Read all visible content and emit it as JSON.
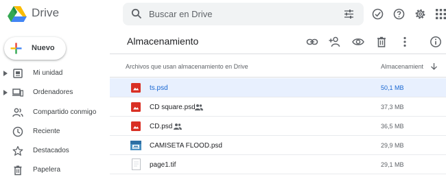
{
  "app": {
    "brand": "Drive"
  },
  "search": {
    "placeholder": "Buscar en Drive"
  },
  "top_icons": [
    "checkmark-circle-icon",
    "help-icon",
    "settings-icon",
    "apps-grid-icon"
  ],
  "sidebar": {
    "new_label": "Nuevo",
    "items": [
      {
        "label": "Mi unidad",
        "icon": "drive-folder-icon",
        "expandable": true
      },
      {
        "label": "Ordenadores",
        "icon": "computers-icon",
        "expandable": true
      },
      {
        "label": "Compartido conmigo",
        "icon": "people-icon",
        "expandable": false
      },
      {
        "label": "Reciente",
        "icon": "clock-icon",
        "expandable": false
      },
      {
        "label": "Destacados",
        "icon": "star-icon",
        "expandable": false
      },
      {
        "label": "Papelera",
        "icon": "trash-icon",
        "expandable": false
      }
    ]
  },
  "main": {
    "title": "Almacenamiento",
    "actions": [
      "link-icon",
      "add-person-icon",
      "preview-eye-icon",
      "delete-icon",
      "more-vert-icon",
      "info-icon"
    ],
    "columns": {
      "name": "Archivos que usan almacenamiento en Drive",
      "size": "Almacenamient"
    },
    "files": [
      {
        "name": "ts.psd",
        "size": "50,1 MB",
        "type": "image",
        "shared": false,
        "selected": true
      },
      {
        "name": "CD square.psd",
        "size": "37,3 MB",
        "type": "image",
        "shared": true,
        "selected": false
      },
      {
        "name": "CD.psd",
        "size": "36,5 MB",
        "type": "image",
        "shared": true,
        "selected": false
      },
      {
        "name": "CAMISETA FLOOD.psd",
        "size": "29,9 MB",
        "type": "thumbnail",
        "shared": false,
        "selected": false
      },
      {
        "name": "page1.tif",
        "size": "29,1 MB",
        "type": "document",
        "shared": false,
        "selected": false
      }
    ]
  },
  "colors": {
    "accent": "#1a73e8",
    "selected_bg": "#e8f0fe",
    "image_red": "#d93025"
  }
}
